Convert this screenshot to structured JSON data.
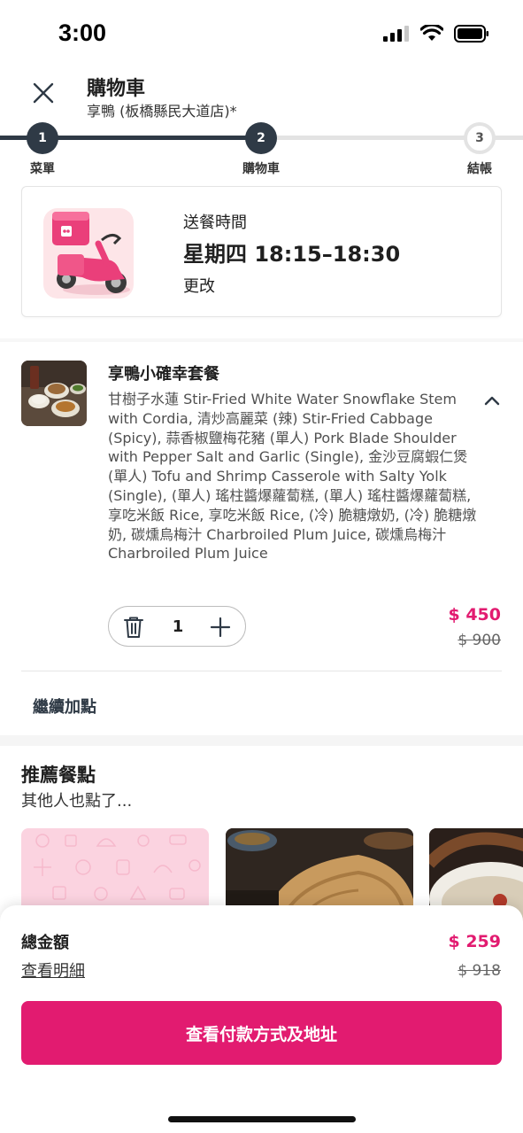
{
  "status_bar": {
    "time": "3:00"
  },
  "header": {
    "title": "購物車",
    "restaurant": "享鴨 (板橋縣民大道店)*"
  },
  "stepper": {
    "steps": [
      {
        "number": "1",
        "label": "菜單",
        "state": "done"
      },
      {
        "number": "2",
        "label": "購物車",
        "state": "done"
      },
      {
        "number": "3",
        "label": "結帳",
        "state": "todo"
      }
    ]
  },
  "delivery": {
    "label": "送餐時間",
    "time": "星期四 18:15–18:30",
    "change": "更改"
  },
  "cart_item": {
    "title": "享鴨小確幸套餐",
    "description": "甘樹子水蓮 Stir-Fried White Water Snowflake Stem with Cordia, 清炒高麗菜 (辣) Stir-Fried Cabbage (Spicy), 蒜香椒鹽梅花豬 (單人) Pork Blade Shoulder with Pepper Salt and Garlic (Single), 金沙豆腐蝦仁煲 (單人) Tofu and Shrimp Casserole with Salty Yolk (Single), (單人) 瑤柱醬爆蘿蔔糕, (單人) 瑤柱醬爆蘿蔔糕, 享吃米飯 Rice, 享吃米飯 Rice, (冷) 脆糖燉奶, (冷) 脆糖燉奶, 碳燻烏梅汁 Charbroiled Plum Juice, 碳燻烏梅汁 Charbroiled Plum Juice",
    "quantity": "1",
    "price": "$ 450",
    "original_price": "$ 900"
  },
  "add_more": "繼續加點",
  "recommendations": {
    "title": "推薦餐點",
    "subtitle": "其他人也點了..."
  },
  "summary": {
    "total_label": "總金額",
    "detail_link": "查看明細",
    "total_price": "$ 259",
    "total_original": "$ 918",
    "checkout_label": "查看付款方式及地址"
  },
  "colors": {
    "brand": "#e21b70",
    "dark": "#2f3a46"
  }
}
